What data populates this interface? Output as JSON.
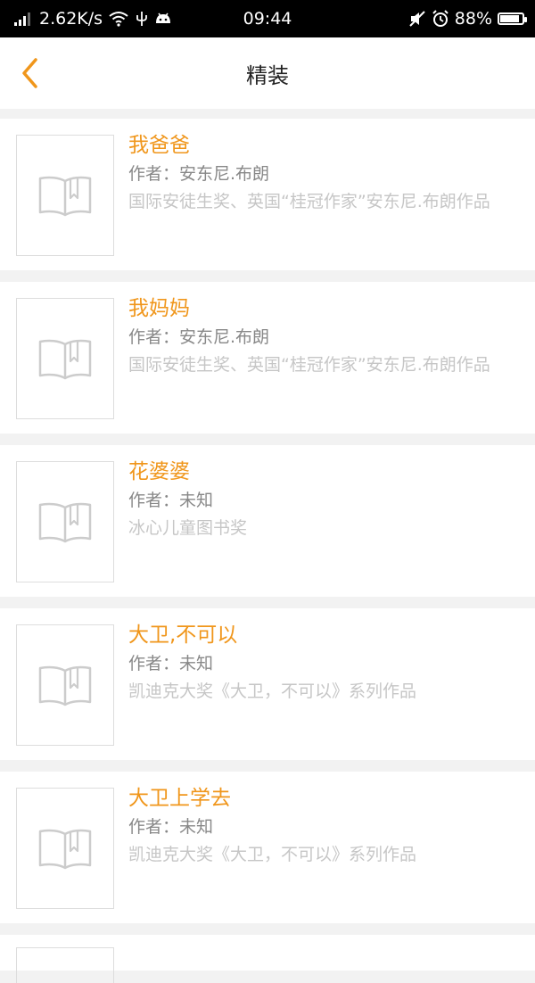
{
  "status_bar": {
    "speed": "2.62K/s",
    "time": "09:44",
    "battery": "88%",
    "battery_level": 0.88
  },
  "header": {
    "title": "精装",
    "back_icon": "chevron-left-icon"
  },
  "books": [
    {
      "title": "我爸爸",
      "author": "作者：安东尼.布朗",
      "desc": "国际安徒生奖、英国“桂冠作家”安东尼.布朗作品"
    },
    {
      "title": "我妈妈",
      "author": "作者：安东尼.布朗",
      "desc": "国际安徒生奖、英国“桂冠作家”安东尼.布朗作品"
    },
    {
      "title": "花婆婆",
      "author": "作者：未知",
      "desc": "冰心儿童图书奖"
    },
    {
      "title": "大卫,不可以",
      "author": "作者：未知",
      "desc": "凯迪克大奖《大卫，不可以》系列作品"
    },
    {
      "title": "大卫上学去",
      "author": "作者：未知",
      "desc": "凯迪克大奖《大卫，不可以》系列作品"
    }
  ],
  "colors": {
    "accent": "#f0961b",
    "author_text": "#888888",
    "desc_text": "#c6c6c6"
  }
}
